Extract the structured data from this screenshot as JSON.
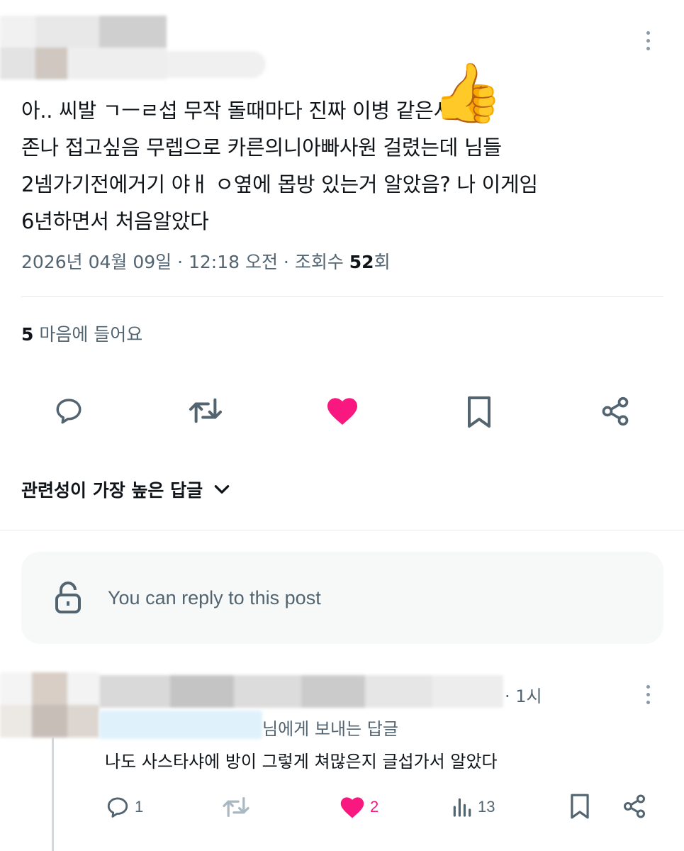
{
  "post": {
    "author_hidden": true,
    "lines": [
      "아.. 씨발 ㄱㅡㄹ섭 무작 돌때마다 진짜 이병 같은서버",
      "존나 접고싶음 무렙으로 카른의니아빠사원 걸렸는데 님들",
      "2넴가기전에거기 야ㅐ ㅇ옆에 몹방 있는거 알았음? 나 이게임",
      "6년하면서 처음알았다"
    ],
    "timestamp": "2026년 04월 09일 · 12:18 오전 · 조회수 ",
    "views": "52",
    "views_suffix": "회",
    "like_count": "5",
    "like_label": " 마음에 들어요",
    "emoji": "👍"
  },
  "actions": [
    "reply-icon",
    "repost-icon",
    "like-icon",
    "bookmark-icon",
    "share-icon"
  ],
  "sort_label": "관련성이 가장 높은 답글",
  "reply_box": {
    "text": "You can reply to this post"
  },
  "reply": {
    "time": "· 1시",
    "reply_to_suffix": "님에게 보내는 답글",
    "text": "나도 사스타샤에 방이 그렇게 쳐많은지 글섭가서 알았다",
    "reply_count": "1",
    "like_count": "2",
    "view_count": "13"
  },
  "colors": {
    "like_pink": "#f91880",
    "icon_gray": "#536471",
    "accent_blue": "#1d9bf0"
  }
}
